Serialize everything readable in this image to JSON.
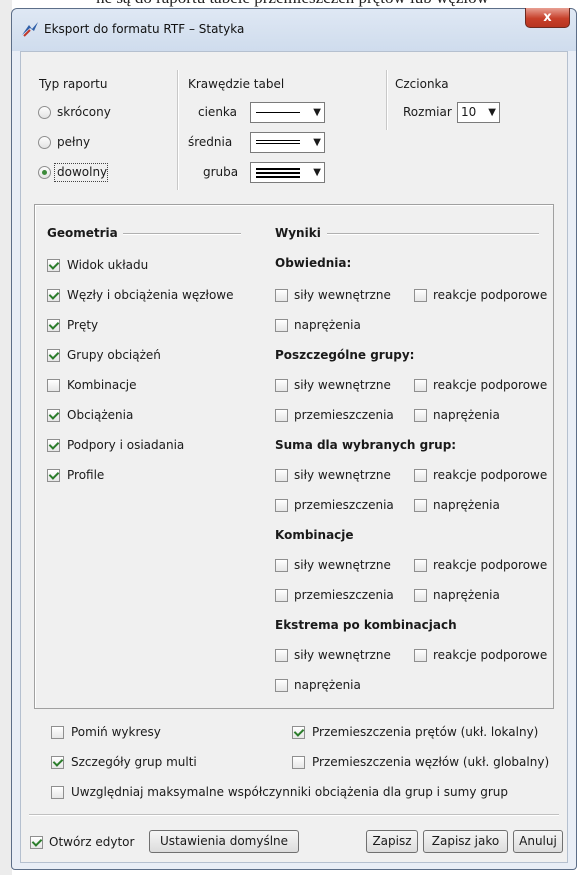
{
  "background_text": "ne są do raportu tabele przemieszczeń prętów lub węzłów",
  "window": {
    "title": "Eksport do formatu RTF – Statyka",
    "close_label": "x"
  },
  "report_type": {
    "header": "Typ raportu",
    "options": [
      {
        "label": "skrócony",
        "selected": false
      },
      {
        "label": "pełny",
        "selected": false
      },
      {
        "label": "dowolny",
        "selected": true
      }
    ]
  },
  "table_borders": {
    "header": "Krawędzie tabel",
    "rows": [
      {
        "label": "cienka"
      },
      {
        "label": "średnia"
      },
      {
        "label": "gruba"
      }
    ]
  },
  "font": {
    "header": "Czcionka",
    "size_label": "Rozmiar",
    "size_value": "10"
  },
  "geometry": {
    "header": "Geometria",
    "items": [
      {
        "label": "Widok układu",
        "checked": true
      },
      {
        "label": "Węzły i obciążenia węzłowe",
        "checked": true
      },
      {
        "label": "Pręty",
        "checked": true
      },
      {
        "label": "Grupy obciążeń",
        "checked": true
      },
      {
        "label": "Kombinacje",
        "checked": false
      },
      {
        "label": "Obciążenia",
        "checked": true
      },
      {
        "label": "Podpory i osiadania",
        "checked": true
      },
      {
        "label": "Profile",
        "checked": true
      }
    ]
  },
  "results": {
    "header": "Wyniki",
    "sections": [
      {
        "title": "Obwiednia:",
        "items": [
          "siły wewnętrzne",
          "reakcje podporowe",
          "naprężenia"
        ]
      },
      {
        "title": "Poszczególne grupy:",
        "items": [
          "siły wewnętrzne",
          "reakcje podporowe",
          "przemieszczenia",
          "naprężenia"
        ]
      },
      {
        "title": "Suma dla wybranych grup:",
        "items": [
          "siły wewnętrzne",
          "reakcje podporowe",
          "przemieszczenia",
          "naprężenia"
        ]
      },
      {
        "title": "Kombinacje",
        "items": [
          "siły wewnętrzne",
          "reakcje podporowe",
          "przemieszczenia",
          "naprężenia"
        ]
      },
      {
        "title": "Ekstrema po kombinacjach",
        "items": [
          "siły wewnętrzne",
          "reakcje podporowe",
          "naprężenia"
        ]
      }
    ]
  },
  "options": {
    "skip_charts": {
      "label": "Pomiń wykresy",
      "checked": false
    },
    "bar_displacements": {
      "label": "Przemieszczenia prętów (ukł. lokalny)",
      "checked": true
    },
    "multi_group_details": {
      "label": "Szczegóły grup multi",
      "checked": true
    },
    "node_displacements": {
      "label": "Przemieszczenia węzłów (ukł. globalny)",
      "checked": false
    },
    "max_factors": {
      "label": "Uwzględniaj maksymalne współczynniki obciążenia dla grup i sumy grup",
      "checked": false
    }
  },
  "footer": {
    "open_editor": {
      "label": "Otwórz edytor",
      "checked": true
    },
    "defaults_label": "Ustawienia domyślne",
    "save_label": "Zapisz",
    "save_as_label": "Zapisz jako",
    "cancel_label": "Anuluj"
  }
}
